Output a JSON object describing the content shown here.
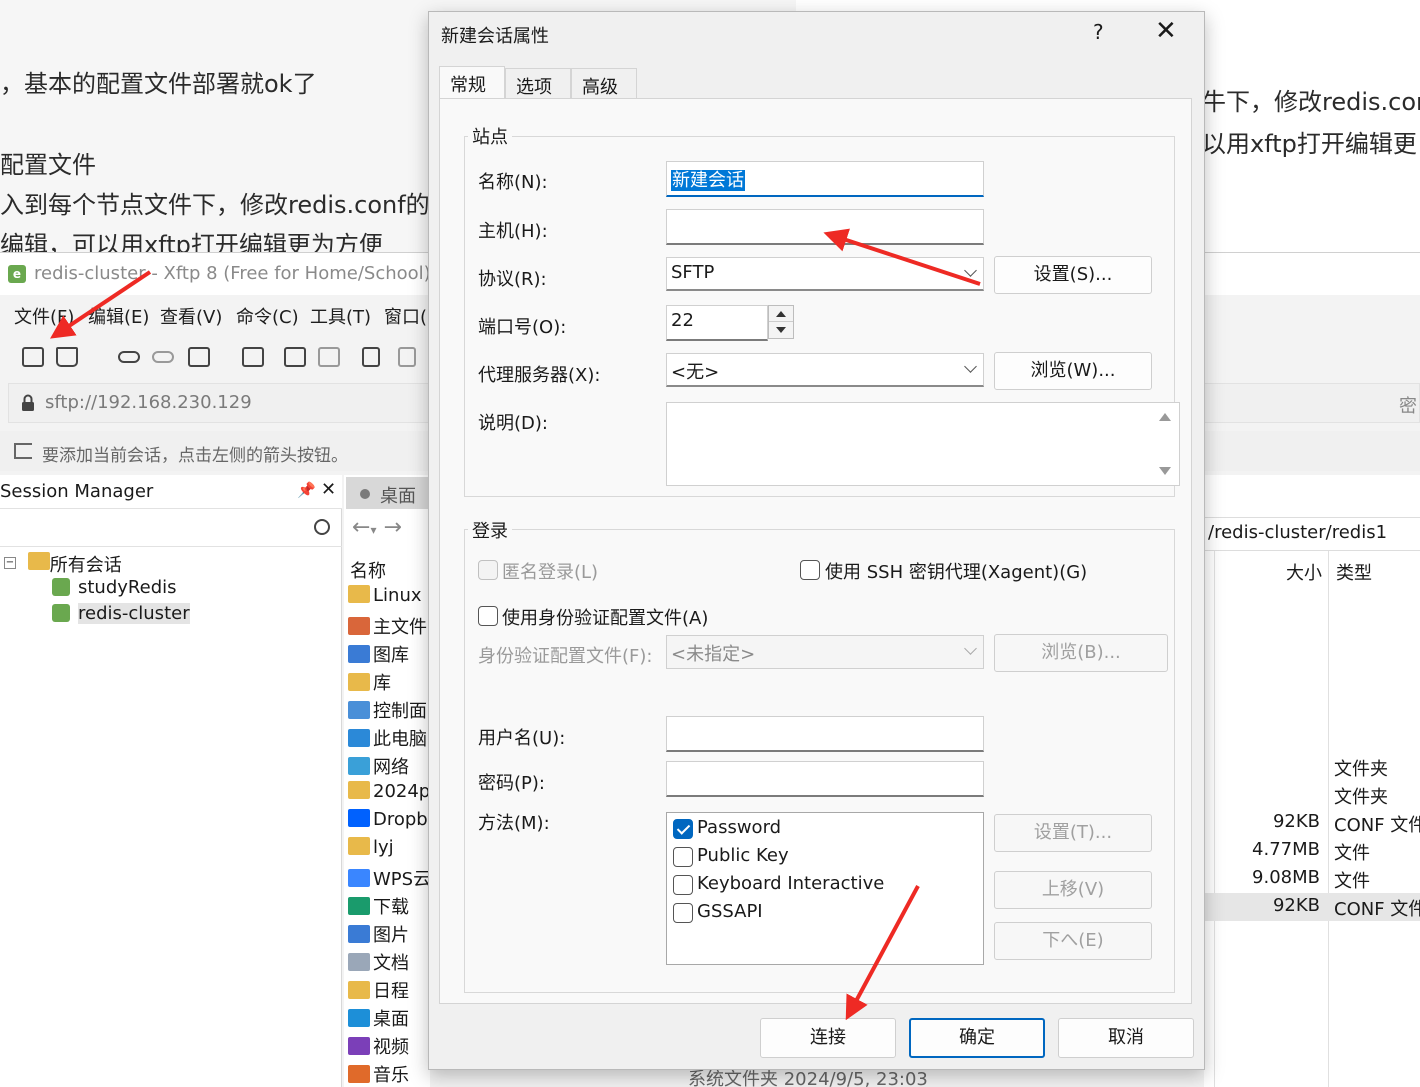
{
  "article": {
    "line1": "，基本的配置文件部署就ok了",
    "line2": "配置文件",
    "line3": "入到每个节点文件下，修改redis.conf的",
    "line4": "编辑，可以用xftp打开编辑更为方便",
    "right_line1": "牛下，修改redis.con",
    "right_line2": "以用xftp打开编辑更"
  },
  "xftp": {
    "title": "redis-cluster - Xftp 8 (Free for Home/School)",
    "app_icon": "xftp-logo",
    "menus": [
      "文件(F)",
      "编辑(E)",
      "查看(V)",
      "命令(C)",
      "工具(T)",
      "窗口("
    ],
    "address": "sftp://192.168.230.129",
    "address_right": "密",
    "hint": "要添加当前会话，点击左侧的箭头按钮。",
    "session_manager": {
      "title": "Session Manager",
      "pin_icon": "pin-icon",
      "close_icon": "close-icon",
      "root": "所有会话",
      "items": [
        "studyRedis",
        "redis-cluster"
      ],
      "selected": "redis-cluster"
    },
    "local": {
      "tab": "桌面",
      "column_name": "名称",
      "items": [
        {
          "name": "Linux",
          "icon": "folder-icon"
        },
        {
          "name": "主文件",
          "icon": "home-icon"
        },
        {
          "name": "图库",
          "icon": "gallery-icon"
        },
        {
          "name": "库",
          "icon": "folder-icon"
        },
        {
          "name": "控制面",
          "icon": "control-panel-icon"
        },
        {
          "name": "此电脑",
          "icon": "computer-icon"
        },
        {
          "name": "网络",
          "icon": "network-icon"
        },
        {
          "name": "2024p",
          "icon": "folder-icon"
        },
        {
          "name": "Dropb",
          "icon": "dropbox-icon"
        },
        {
          "name": "lyj",
          "icon": "folder-icon"
        },
        {
          "name": "WPS云",
          "icon": "cloud-icon"
        },
        {
          "name": "下载",
          "icon": "download-icon"
        },
        {
          "name": "图片",
          "icon": "pictures-icon"
        },
        {
          "name": "文档",
          "icon": "documents-icon"
        },
        {
          "name": "日程",
          "icon": "folder-icon"
        },
        {
          "name": "桌面",
          "icon": "desktop-icon"
        },
        {
          "name": "视频",
          "icon": "videos-icon"
        },
        {
          "name": "音乐",
          "icon": "music-icon"
        }
      ]
    },
    "remote": {
      "path": "/redis-cluster/redis1",
      "col_size": "大小",
      "col_type": "类型",
      "rows": [
        {
          "size": "",
          "type": "文件夹"
        },
        {
          "size": "",
          "type": "文件夹"
        },
        {
          "size": "92KB",
          "type": "CONF 文件"
        },
        {
          "size": "4.77MB",
          "type": "文件"
        },
        {
          "size": "9.08MB",
          "type": "文件"
        },
        {
          "size": "92KB",
          "type": "CONF 文件"
        }
      ]
    },
    "bottom_strip": "系统文件夹        2024/9/5, 23:03"
  },
  "dialog": {
    "title": "新建会话属性",
    "help": "?",
    "close": "✕",
    "tabs": [
      "常规",
      "选项",
      "高级"
    ],
    "active_tab": "常规",
    "site": {
      "group": "站点",
      "name_label": "名称(N):",
      "name_value": "新建会话",
      "host_label": "主机(H):",
      "host_value": "",
      "protocol_label": "协议(R):",
      "protocol_value": "SFTP",
      "settings_button": "设置(S)...",
      "port_label": "端口号(O):",
      "port_value": "22",
      "proxy_label": "代理服务器(X):",
      "proxy_value": "<无>",
      "browse_button": "浏览(W)...",
      "desc_label": "说明(D):",
      "desc_value": ""
    },
    "login": {
      "group": "登录",
      "anonymous": "匿名登录(L)",
      "ssh_agent": "使用 SSH 密钥代理(Xagent)(G)",
      "use_profile": "使用身份验证配置文件(A)",
      "profile_label": "身份验证配置文件(F):",
      "profile_value": "<未指定>",
      "profile_browse": "浏览(B)...",
      "user_label": "用户名(U):",
      "user_value": "",
      "pass_label": "密码(P):",
      "pass_value": "",
      "method_label": "方法(M):",
      "methods": [
        {
          "name": "Password",
          "checked": true
        },
        {
          "name": "Public Key",
          "checked": false
        },
        {
          "name": "Keyboard Interactive",
          "checked": false
        },
        {
          "name": "GSSAPI",
          "checked": false
        }
      ],
      "method_settings": "设置(T)...",
      "move_up": "上移(V)",
      "move_down": "下へ(E)"
    },
    "buttons": {
      "connect": "连接",
      "ok": "确定",
      "cancel": "取消"
    }
  },
  "colors": {
    "accent": "#0067c0",
    "arrow": "#ee2a24",
    "selection": "#0078d7"
  }
}
